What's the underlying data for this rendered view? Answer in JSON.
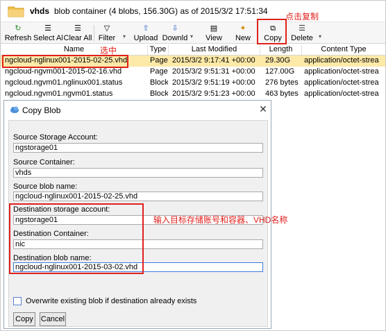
{
  "header": {
    "name": "vhds",
    "description": "blob container  (4 blobs, 156.30G) as of 2015/3/2 17:51:34"
  },
  "toolbar": {
    "buttons": [
      {
        "icon": "↻",
        "label": "Refresh"
      },
      {
        "icon": "☰",
        "label": "Select Al"
      },
      {
        "icon": "☰",
        "label": "Clear All"
      },
      {
        "icon": "▽",
        "label": "Filter"
      },
      {
        "icon": "⇧",
        "label": "Upload"
      },
      {
        "icon": "⇩",
        "label": "Downld"
      },
      {
        "icon": "▤",
        "label": "View"
      },
      {
        "icon": "✦",
        "label": "New"
      },
      {
        "icon": "⧉",
        "label": "Copy"
      },
      {
        "icon": "☰",
        "label": "Delete"
      }
    ]
  },
  "table": {
    "columns": [
      "Name",
      "Type",
      "Last Modified",
      "Length",
      "Content Type"
    ],
    "rows": [
      {
        "name": "ngcloud-nglinux001-2015-02-25.vhd",
        "type": "Page",
        "modified": "2015/3/2 9:17:41 +00:00",
        "length": "29.30G",
        "content_type": "application/octet-strea"
      },
      {
        "name": "ngcloud-ngvm001-2015-02-16.vhd",
        "type": "Page",
        "modified": "2015/3/2 9:51:31 +00:00",
        "length": "127.00G",
        "content_type": "application/octet-strea"
      },
      {
        "name": "ngcloud.ngvm01.nglinux001.status",
        "type": "Block",
        "modified": "2015/3/2 9:51:19 +00:00",
        "length": "276 bytes",
        "content_type": "application/octet-strea"
      },
      {
        "name": "ngcloud.ngvm01.ngvm01.status",
        "type": "Block",
        "modified": "2015/3/2 9:51:23 +00:00",
        "length": "463 bytes",
        "content_type": "application/octet-strea"
      }
    ]
  },
  "annotations": {
    "copy_note": "点击复制",
    "select_note": "选中",
    "dest_note": "输入目标存储账号和容器、VHD名称",
    "color": "#e0201b"
  },
  "dialog": {
    "title": "Copy Blob",
    "close_glyph": "✕",
    "source_account_label": "Source Storage Account:",
    "source_account_value": "ngstorage01",
    "source_container_label": "Source Container:",
    "source_container_value": "vhds",
    "source_blob_label": "Source blob name:",
    "source_blob_value": "ngcloud-nglinux001-2015-02-25.vhd",
    "dest_account_label": "Destination storage account:",
    "dest_account_value": "ngstorage01",
    "dest_container_label": "Destination Container:",
    "dest_container_value": "nic",
    "dest_blob_label": "Destination blob name:",
    "dest_blob_value": "ngcloud-nglinux001-2015-03-02.vhd",
    "overwrite_label": "Overwrite existing blob if destination already exists",
    "copy_button": "Copy",
    "cancel_button": "Cancel"
  },
  "colors": {
    "selected_row": "#fde9a8",
    "accent": "#3d7bd9"
  }
}
